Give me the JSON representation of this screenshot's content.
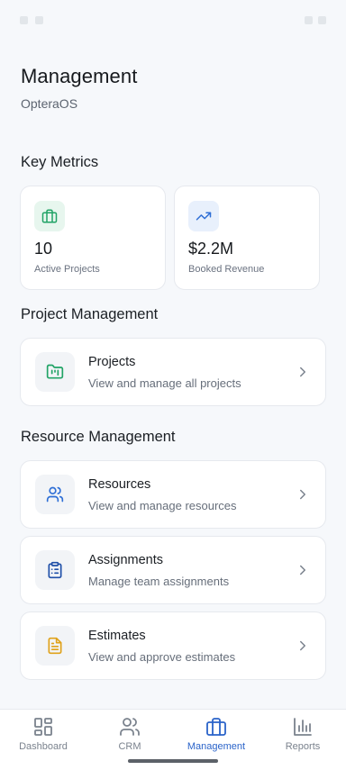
{
  "header": {
    "title": "Management",
    "subtitle": "OpteraOS"
  },
  "sections": {
    "key_metrics": "Key Metrics",
    "project_management": "Project Management",
    "resource_management": "Resource Management"
  },
  "metrics": [
    {
      "value": "10",
      "label": "Active Projects",
      "icon": "briefcase-icon",
      "accent": "#21a366",
      "bg": "#e7f6ee"
    },
    {
      "value": "$2.2M",
      "label": "Booked Revenue",
      "icon": "trending-up-icon",
      "accent": "#2f6fd6",
      "bg": "#e8f0fc"
    }
  ],
  "project_items": [
    {
      "title": "Projects",
      "desc": "View and manage all projects",
      "icon": "folder-kanban-icon",
      "accent": "#21a366"
    }
  ],
  "resource_items": [
    {
      "title": "Resources",
      "desc": "View and manage resources",
      "icon": "users-icon",
      "accent": "#2f6fd6"
    },
    {
      "title": "Assignments",
      "desc": "Manage team assignments",
      "icon": "clipboard-list-icon",
      "accent": "#1f4fa8"
    },
    {
      "title": "Estimates",
      "desc": "View and approve estimates",
      "icon": "file-text-icon",
      "accent": "#e0a21b"
    }
  ],
  "bottom_nav": {
    "tabs": [
      {
        "label": "Dashboard",
        "icon": "grid-icon"
      },
      {
        "label": "CRM",
        "icon": "users-icon"
      },
      {
        "label": "Management",
        "icon": "briefcase-icon",
        "active": true
      },
      {
        "label": "Reports",
        "icon": "bar-chart-icon"
      }
    ],
    "active_color": "#2a63c9",
    "inactive_color": "#7a828d"
  }
}
